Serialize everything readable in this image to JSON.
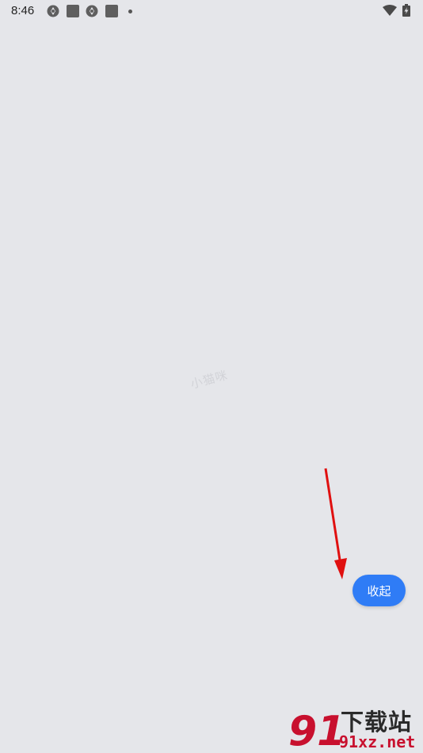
{
  "status_bar": {
    "time": "8:46",
    "icons": [
      "aperture-icon",
      "square-notification-icon",
      "aperture-icon",
      "square-notification-icon",
      "dot-icon",
      "wifi-icon",
      "battery-charging-icon"
    ]
  },
  "watermark": {
    "text": "小猫咪"
  },
  "collapse_button": {
    "label": "收起",
    "color": "#2f7cf6"
  },
  "annotation": {
    "arrow_color": "#e01010"
  },
  "site_logo": {
    "title": "下载站",
    "domain": "91xz.net",
    "mark_text": "91"
  },
  "colors": {
    "background": "#e5e6ea",
    "logo_red": "#c8102e"
  }
}
